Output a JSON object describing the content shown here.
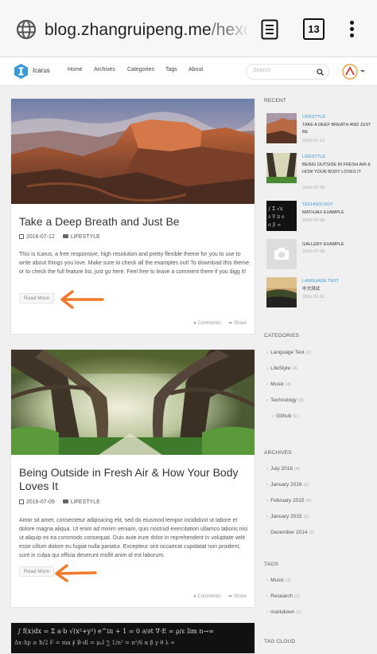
{
  "browser": {
    "url_host": "blog.zhangruipeng.me",
    "url_path": "/hexo-th",
    "tab_count": "13"
  },
  "navbar": {
    "brand": "Icarus",
    "items": [
      "Home",
      "Archives",
      "Categories",
      "Tags",
      "About"
    ],
    "search_placeholder": "Search"
  },
  "articles": [
    {
      "title": "Take a Deep Breath and Just Be",
      "date": "2016-07-12",
      "category": "LIFESTYLE",
      "excerpt": "This is Icarus, a free responsive, high resolution and pretty flexible theme for you to use to write about things you love. Make sure to check all the examples out! To download this theme or to check the full feature list, just go here. Feel free to leave a comment there if you digg it!",
      "read_more": "Read More",
      "comments": "Comments",
      "share": "Share"
    },
    {
      "title": "Being Outside in Fresh Air & How Your Body Loves It",
      "date": "2016-07-09",
      "category": "LIFESTYLE",
      "excerpt": "Amor sit amet, consectetur adipisicing elit, sed do eiusmod tempor incididunt ut labore et dolore magna aliqua. Ut enim ad minim veniam, quis nostrud exercitation ullamco laboris nisi ut aliquip ex ea commodo consequat. Duis aute irure dolor in reprehenderit in voluptate velit esse cillum dolore eu fugiat nulla pariatur. Excepteur sint occaecat cupidatat non proident, sunt in culpa qui officia deserunt mollit anim id est laborum.",
      "read_more": "Read More",
      "comments": "Comments",
      "share": "Share"
    }
  ],
  "sidebar": {
    "recent_title": "RECENT",
    "recent": [
      {
        "category": "LIFESTYLE",
        "title": "TAKE A DEEP BREATH AND JUST BE",
        "date": "2016-07-12"
      },
      {
        "category": "LIFESTYLE",
        "title": "BEING OUTSIDE IN FRESH AIR & HOW YOUR BODY LOVES IT",
        "date": "2016-07-09"
      },
      {
        "category": "TECHNOLOGY",
        "title": "MATHJAX EXAMPLE",
        "date": "2016-07-08"
      },
      {
        "category": "",
        "title": "GALLERY EXAMPLE",
        "date": "2016-07-08"
      },
      {
        "category": "LANGUAGE TEST",
        "title": "中文测试",
        "date": "2016-01-31"
      }
    ],
    "categories_title": "CATEGORIES",
    "categories": [
      {
        "name": "Language Test",
        "count": "(2)"
      },
      {
        "name": "LifeStyle",
        "count": "(4)"
      },
      {
        "name": "Music",
        "count": "(4)"
      },
      {
        "name": "Technology",
        "count": "(2)"
      },
      {
        "name": "Github",
        "count": "(1)"
      }
    ],
    "archives_title": "ARCHIVES",
    "archives": [
      {
        "name": "July 2016",
        "count": "(4)"
      },
      {
        "name": "January 2016",
        "count": "(2)"
      },
      {
        "name": "February 2015",
        "count": "(4)"
      },
      {
        "name": "January 2015",
        "count": "(1)"
      },
      {
        "name": "December 2014",
        "count": "(2)"
      }
    ],
    "tags_title": "TAGS",
    "tags": [
      {
        "name": "Music",
        "count": "(2)"
      },
      {
        "name": "Research",
        "count": "(1)"
      },
      {
        "name": "markdown",
        "count": "(1)"
      }
    ],
    "tagcloud_title": "TAG CLOUD"
  },
  "colors": {
    "accent": "#3b99d7",
    "arrow": "#f07a2a"
  }
}
